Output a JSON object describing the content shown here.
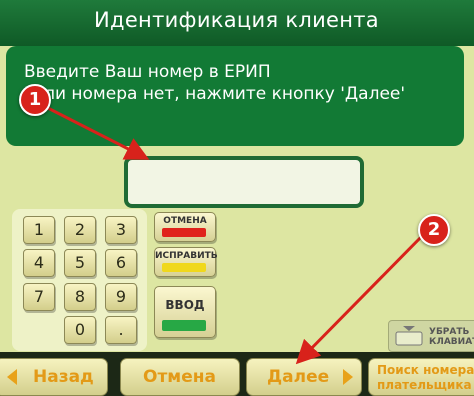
{
  "header": {
    "title": "Идентификация клиента"
  },
  "message": {
    "line1": "Введите Ваш номер в ЕРИП",
    "line2": "Если номера нет, нажмите кнопку 'Далее'"
  },
  "input": {
    "value": ""
  },
  "keypad": {
    "keys": [
      "1",
      "2",
      "3",
      "4",
      "5",
      "6",
      "7",
      "8",
      "9",
      "0",
      "."
    ]
  },
  "function_keys": {
    "cancel": {
      "label": "ОТМЕНА",
      "color": "#e0231c"
    },
    "correct": {
      "label": "ИСПРАВИТЬ",
      "color": "#f0d81c"
    },
    "enter": {
      "label": "ВВОД",
      "color": "#27a845"
    }
  },
  "keyboard_button": {
    "label_line1": "УБРАТЬ",
    "label_line2": "КЛАВИАТУРУ"
  },
  "bottom_bar": {
    "back": "Назад",
    "cancel": "Отмена",
    "next": "Далее",
    "search": "Поиск номера",
    "search_line2": "плательщика"
  },
  "annotations": {
    "badge1": "1",
    "badge2": "2",
    "color": "#d8221b"
  }
}
